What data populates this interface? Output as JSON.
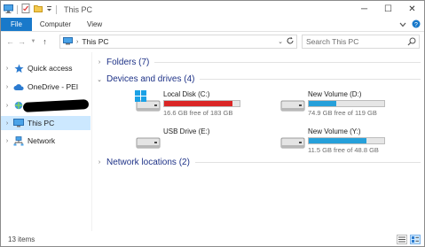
{
  "window": {
    "title": "This PC"
  },
  "titlebar": {
    "minimize": "─",
    "maximize": "☐",
    "close": "✕"
  },
  "ribbon": {
    "tabs": [
      "File",
      "Computer",
      "View"
    ]
  },
  "address": {
    "path": "This PC"
  },
  "search": {
    "placeholder": "Search This PC"
  },
  "nav": {
    "items": [
      {
        "label": "Quick access",
        "icon": "star-icon"
      },
      {
        "label": "OneDrive - PEI",
        "icon": "cloud-icon"
      },
      {
        "label": "",
        "icon": "network-drive-icon",
        "redacted": true
      },
      {
        "label": "This PC",
        "icon": "computer-icon",
        "selected": true
      },
      {
        "label": "Network",
        "icon": "network-icon"
      }
    ]
  },
  "groups": {
    "folders": "Folders (7)",
    "devices": "Devices and drives (4)",
    "network": "Network locations (2)"
  },
  "drives": [
    {
      "name": "Local Disk (C:)",
      "free": "16.6 GB free of 183 GB",
      "used_fraction": 0.91,
      "bar_color": "#da2626",
      "icon": "windows-drive-icon"
    },
    {
      "name": "New Volume (D:)",
      "free": "74.9 GB free of 119 GB",
      "used_fraction": 0.37,
      "bar_color": "#26a0da",
      "icon": "hard-drive-icon"
    },
    {
      "name": "USB Drive (E:)",
      "free": "",
      "used_fraction": null,
      "bar_color": "",
      "icon": "usb-drive-icon"
    },
    {
      "name": "New Volume (Y:)",
      "free": "11.5 GB free of 48.8 GB",
      "used_fraction": 0.76,
      "bar_color": "#26a0da",
      "icon": "hard-drive-icon"
    }
  ],
  "status": {
    "count": "13 items"
  },
  "colors": {
    "accent": "#1979ca",
    "selection": "#cce8ff",
    "group_heading": "#1e3287"
  }
}
